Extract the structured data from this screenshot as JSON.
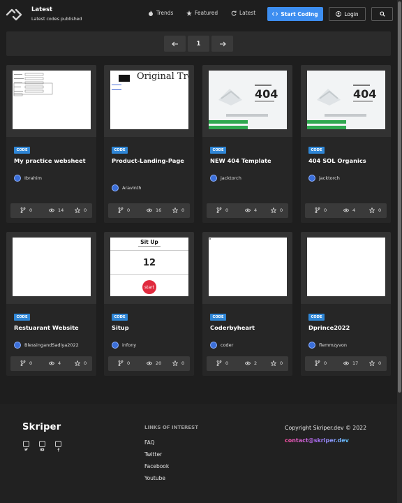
{
  "header": {
    "title": "Latest",
    "subtitle": "Latest codes published",
    "nav": [
      {
        "label": "Trends",
        "icon": "fire-icon"
      },
      {
        "label": "Featured",
        "icon": "star-icon"
      },
      {
        "label": "Latest",
        "icon": "refresh-icon"
      }
    ],
    "start_label": "Start Coding",
    "login_label": "Login"
  },
  "pager": {
    "current": "1"
  },
  "colors": {
    "accent": "#3d8ef0",
    "badge": "#2f86d6",
    "background": "#1e1e1e"
  },
  "cards": [
    {
      "badge": "CODE",
      "title": "My practice websheet",
      "author": "Ibrahim",
      "forks": "0",
      "views": "14",
      "stars": "0"
    },
    {
      "badge": "CODE",
      "title": "Product-Landing-Page",
      "author": "Aravinth",
      "forks": "0",
      "views": "16",
      "stars": "0",
      "thumb_text": "Original Tron"
    },
    {
      "badge": "CODE",
      "title": "NEW 404 Template",
      "author": "jacktorch",
      "forks": "0",
      "views": "4",
      "stars": "0",
      "thumb_text": "404"
    },
    {
      "badge": "CODE",
      "title": "404 SOL Organics",
      "author": "jacktorch",
      "forks": "0",
      "views": "4",
      "stars": "0",
      "thumb_text": "404"
    },
    {
      "badge": "CODE",
      "title": "Restuarant Website",
      "author": "BlessingandSadiya2022",
      "forks": "0",
      "views": "4",
      "stars": "0"
    },
    {
      "badge": "CODE",
      "title": "Situp",
      "author": "infony",
      "forks": "0",
      "views": "20",
      "stars": "0",
      "thumb_text": "Sit Up",
      "thumb_num": "12",
      "thumb_btn": "start"
    },
    {
      "badge": "CODE",
      "title": "Coderbyheart",
      "author": "coder",
      "forks": "0",
      "views": "2",
      "stars": "0"
    },
    {
      "badge": "CODE",
      "title": "Dprince2022",
      "author": "flemmzyvon",
      "forks": "0",
      "views": "17",
      "stars": "0"
    }
  ],
  "footer": {
    "brand": "Skriper",
    "links_heading": "LINKS OF INTEREST",
    "links": [
      "FAQ",
      "Twitter",
      "Facebook",
      "Youtube"
    ],
    "copyright": "Copyright Skriper.dev © 2022",
    "contact": "contact@skriper.dev"
  }
}
